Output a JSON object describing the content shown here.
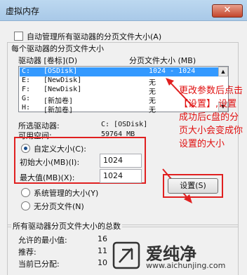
{
  "window": {
    "title": "虚拟内存",
    "close_icon": "✕"
  },
  "auto_manage": {
    "label": "自动管理所有驱动器的分页文件大小(A)",
    "checked": false
  },
  "section_label": "每个驱动器的分页文件大小",
  "list": {
    "col_drive": "驱动器 [卷标](D)",
    "col_size": "分页文件大小 (MB)",
    "rows": [
      {
        "drive": "C:",
        "label": "[OSDisk]",
        "size": "1024 - 1024"
      },
      {
        "drive": "E:",
        "label": "[NewDisk]",
        "size": "无"
      },
      {
        "drive": "F:",
        "label": "[NewDisk]",
        "size": "无"
      },
      {
        "drive": "G:",
        "label": "[新加卷]",
        "size": "无"
      },
      {
        "drive": "H:",
        "label": "[新加卷]",
        "size": "无"
      }
    ]
  },
  "selected": {
    "drive_label": "所选驱动器:",
    "drive_value": "C:  [OSDisk]",
    "space_label": "可用空间:",
    "space_value": "59764 MB"
  },
  "custom": {
    "label": "自定义大小(C):",
    "initial_label": "初始大小(MB)(I):",
    "initial_value": "1024",
    "max_label": "最大值(MB)(X):",
    "max_value": "1024"
  },
  "system_managed": {
    "label": "系统管理的大小(Y)"
  },
  "no_paging": {
    "label": "无分页文件(N)"
  },
  "set_button": "设置(S)",
  "totals": {
    "title": "所有驱动器分页文件大小的总数",
    "min_label": "允许的最小值:",
    "min_value": "16",
    "recommended_label": "推荐:",
    "recommended_value": "11",
    "current_label": "当前已分配:",
    "current_value": "10"
  },
  "annotation": "更改参数后点击【设置】,设置成功后c盘的分页大小会变成你设置的大小",
  "watermark": {
    "brand": "爱纯净",
    "url": "www.aichunjing.com"
  }
}
